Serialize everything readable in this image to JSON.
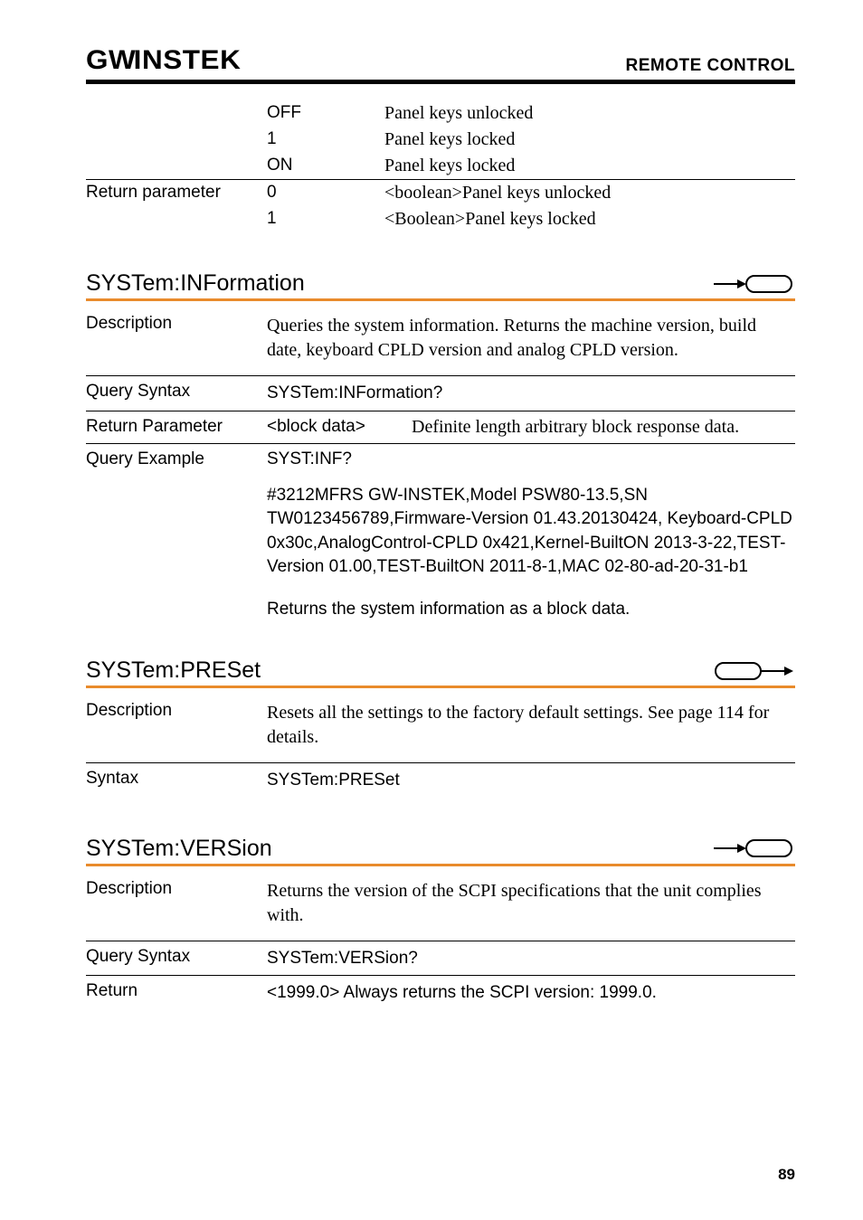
{
  "header": {
    "logo_text": "GWINSTEK",
    "title": "REMOTE CONTROL"
  },
  "top_table": {
    "rows": [
      {
        "label": "",
        "mid": "OFF",
        "val": "Panel keys unlocked"
      },
      {
        "label": "",
        "mid": "1",
        "val": "Panel keys locked"
      },
      {
        "label": "",
        "mid": "ON",
        "val": "Panel keys locked"
      }
    ],
    "return_label": "Return parameter",
    "return_rows": [
      {
        "mid": "0",
        "val": "<boolean>Panel keys unlocked"
      },
      {
        "mid": "1",
        "val": "<Boolean>Panel keys locked"
      }
    ]
  },
  "sections": {
    "info": {
      "title": "SYSTem:INFormation",
      "desc_label": "Description",
      "desc": "Queries the system information. Returns the machine version, build date, keyboard CPLD version and analog CPLD version.",
      "qs_label": "Query Syntax",
      "qs_value": "SYSTem:INFormation?",
      "rp_label": "Return Parameter",
      "rp_mid": "<block data>",
      "rp_val": "Definite length arbitrary block response data.",
      "qe_label": "Query Example",
      "qe_value": "SYST:INF?",
      "example": "#3212MFRS GW-INSTEK,Model PSW80-13.5,SN TW0123456789,Firmware-Version 01.43.20130424, Keyboard-CPLD 0x30c,AnalogControl-CPLD 0x421,Kernel-BuiltON 2013-3-22,TEST-Version 01.00,TEST-BuiltON 2011-8-1,MAC 02-80-ad-20-31-b1",
      "note": "Returns the system information as a block data."
    },
    "preset": {
      "title": "SYSTem:PRESet",
      "desc_label": "Description",
      "desc": "Resets all the settings to the factory default settings. See page 114 for details.",
      "syn_label": "Syntax",
      "syn_value": "SYSTem:PRESet"
    },
    "version": {
      "title": "SYSTem:VERSion",
      "desc_label": "Description",
      "desc": "Returns the version of the SCPI specifications that the unit complies with.",
      "qs_label": "Query Syntax",
      "qs_value": "SYSTem:VERSion?",
      "ret_label": "Return",
      "ret_value": "<1999.0> Always returns the SCPI version: 1999.0."
    }
  },
  "page": "89"
}
